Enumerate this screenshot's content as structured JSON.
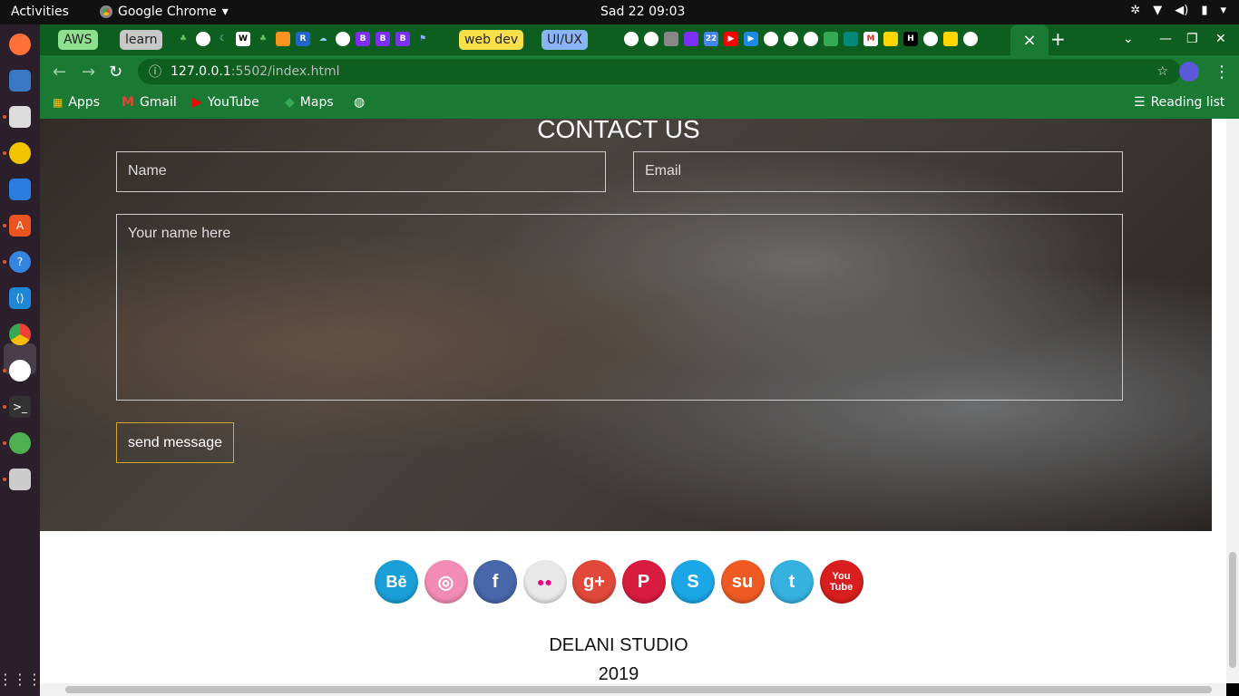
{
  "system": {
    "activities": "Activities",
    "app_name": "Google Chrome",
    "clock": "Sad 22  09:03"
  },
  "tabs": {
    "groups": [
      {
        "label": "AWS",
        "color": "#8fe08f"
      },
      {
        "label": "learn",
        "color": "#c8c8c8"
      },
      {
        "label": "web dev",
        "color": "#f9e04a"
      },
      {
        "label": "UI/UX",
        "color": "#8ab4f8"
      }
    ],
    "active_close": "×",
    "new_tab": "+"
  },
  "toolbar": {
    "url_host": "127.0.0.1",
    "url_rest": ":5502/index.html"
  },
  "bookmarks": {
    "apps": "Apps",
    "gmail": "Gmail",
    "youtube": "YouTube",
    "maps": "Maps",
    "reading_list": "Reading list"
  },
  "contact": {
    "title": "CONTACT US",
    "name_placeholder": "Name",
    "email_placeholder": "Email",
    "message_placeholder": "Your name here",
    "send_label": "send message"
  },
  "social": [
    {
      "name": "behance",
      "glyph": "Bē",
      "color": "#1b9fd9"
    },
    {
      "name": "dribbble",
      "glyph": "◎",
      "color": "#f38cb4"
    },
    {
      "name": "facebook",
      "glyph": "f",
      "color": "#4767aa"
    },
    {
      "name": "flickr",
      "glyph": "●●",
      "color": "#e8e8e8"
    },
    {
      "name": "google-plus",
      "glyph": "g+",
      "color": "#e0493a"
    },
    {
      "name": "pinterest",
      "glyph": "P",
      "color": "#d81c3f"
    },
    {
      "name": "skype",
      "glyph": "S",
      "color": "#1ba6e6"
    },
    {
      "name": "stumbleupon",
      "glyph": "su",
      "color": "#ef5a23"
    },
    {
      "name": "twitter",
      "glyph": "t",
      "color": "#36b1e0"
    },
    {
      "name": "youtube",
      "glyph": "You Tube",
      "color": "#d81e1e"
    }
  ],
  "footer": {
    "studio": "DELANI STUDIO",
    "year": "2019"
  }
}
